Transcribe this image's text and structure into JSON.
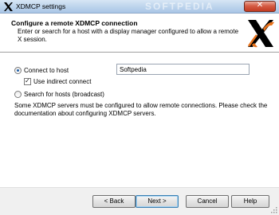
{
  "window": {
    "title": "XDMCP settings",
    "watermark": "SOFTPEDIA",
    "close_glyph": "✕"
  },
  "header": {
    "title": "Configure a remote XDMCP connection",
    "description": "Enter or search for a host with a display manager configured to allow a remote X session."
  },
  "options": {
    "connect_to_host": {
      "label": "Connect to host",
      "selected": true
    },
    "host_value": "Softpedia",
    "use_indirect": {
      "label": "Use indirect connect",
      "checked": true,
      "check_glyph": "✓"
    },
    "search_hosts": {
      "label": "Search for hosts (broadcast)",
      "selected": false
    }
  },
  "note": "Some XDMCP servers must be configured to allow remote connections. Please check the documentation about configuring XDMCP servers.",
  "buttons": {
    "back": "< Back",
    "next": "Next >",
    "cancel": "Cancel",
    "help": "Help"
  },
  "icons": {
    "app": "x-logo-icon",
    "header": "x-logo-icon",
    "close": "close-icon"
  },
  "colors": {
    "logo_black": "#000000",
    "logo_orange": "#e8731c",
    "close_red": "#c23b22"
  }
}
